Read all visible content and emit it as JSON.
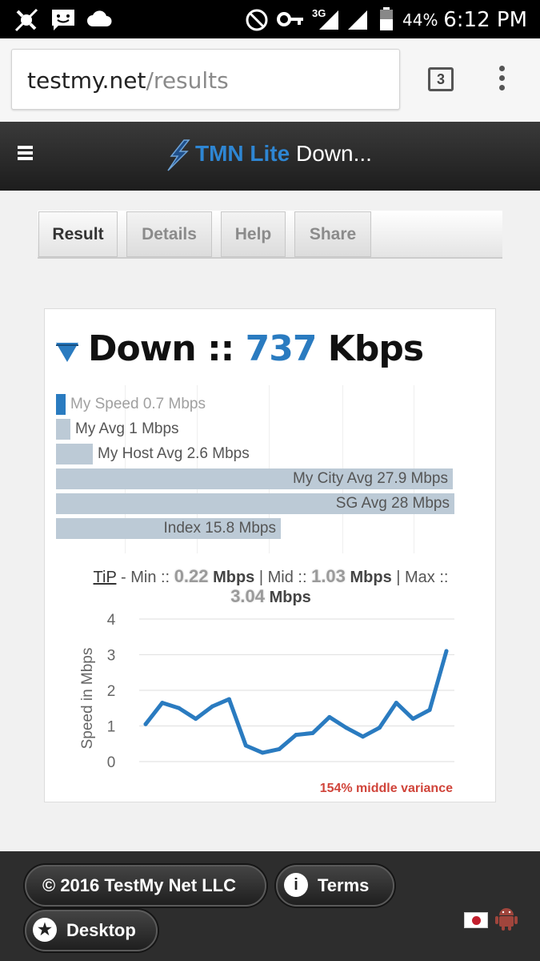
{
  "status_bar": {
    "network": "3G",
    "battery": "44%",
    "time": "6:12 PM"
  },
  "browser": {
    "url_domain": "testmy.net",
    "url_path": "/results",
    "tab_count": "3"
  },
  "site_header": {
    "brand": "TMN Lite",
    "page_title": "Down..."
  },
  "tabs": [
    {
      "label": "Result",
      "active": true
    },
    {
      "label": "Details",
      "active": false
    },
    {
      "label": "Help",
      "active": false
    },
    {
      "label": "Share",
      "active": false
    }
  ],
  "result": {
    "direction": "Down",
    "separator": "::",
    "speed": "737",
    "unit": "Kbps"
  },
  "comparison_bars": [
    {
      "label": "My Speed 0.7 Mbps",
      "value": 0.7,
      "highlight": true
    },
    {
      "label": "My Avg 1 Mbps",
      "value": 1
    },
    {
      "label": "My Host Avg 2.6 Mbps",
      "value": 2.6
    },
    {
      "label": "My City Avg 27.9 Mbps",
      "value": 27.9
    },
    {
      "label": "SG Avg 28 Mbps",
      "value": 28
    },
    {
      "label": "Index 15.8 Mbps",
      "value": 15.8
    }
  ],
  "tip": {
    "link": "TiP",
    "min_label": "- Min ::",
    "min_value": "0.22",
    "mid_label": "| Mid ::",
    "mid_value": "1.03",
    "max_label": "| Max ::",
    "max_value": "3.04",
    "unit": "Mbps"
  },
  "chart_data": {
    "type": "line",
    "ylabel": "Speed in Mbps",
    "ylim": [
      0,
      4
    ],
    "yticks": [
      0,
      1,
      2,
      3,
      4
    ],
    "series": [
      {
        "values": [
          1.05,
          1.65,
          1.5,
          1.2,
          1.55,
          1.75,
          0.45,
          0.25,
          0.35,
          0.75,
          0.8,
          1.25,
          0.95,
          0.7,
          0.95,
          1.65,
          1.2,
          1.45,
          3.1
        ]
      }
    ],
    "grid": true,
    "color": "#2a7bc0"
  },
  "variance": "154% middle variance",
  "footer": {
    "copyright": "© 2016 TestMy Net LLC",
    "terms": "Terms",
    "desktop": "Desktop"
  },
  "colors": {
    "accent": "#2a7bc0",
    "bar": "#bccad6",
    "variance": "#d0443a"
  }
}
